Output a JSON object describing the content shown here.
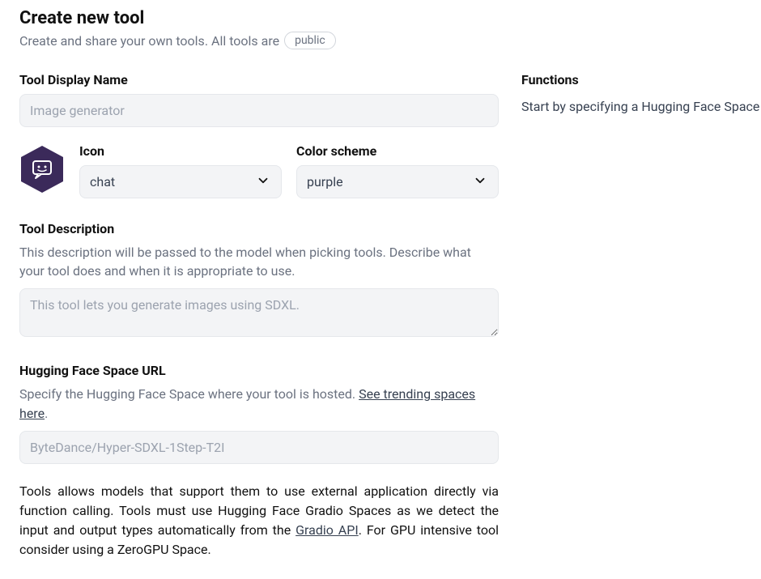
{
  "header": {
    "title": "Create new tool",
    "subtitle_prefix": "Create and share your own tools. All tools are",
    "badge": "public"
  },
  "form": {
    "display_name": {
      "label": "Tool Display Name",
      "placeholder": "Image generator",
      "value": ""
    },
    "icon": {
      "label": "Icon",
      "selected": "chat"
    },
    "color_scheme": {
      "label": "Color scheme",
      "selected": "purple"
    },
    "description": {
      "label": "Tool Description",
      "helper": "This description will be passed to the model when picking tools. Describe what your tool does and when it is appropriate to use.",
      "placeholder": "This tool lets you generate images using SDXL.",
      "value": ""
    },
    "space_url": {
      "label": "Hugging Face Space URL",
      "helper_prefix": "Specify the Hugging Face Space where your tool is hosted. ",
      "helper_link": "See trending spaces here",
      "helper_suffix": ".",
      "placeholder": "ByteDance/Hyper-SDXL-1Step-T2I",
      "value": ""
    },
    "footnote_pre": "Tools allows models that support them to use external application directly via function calling. Tools must use Hugging Face Gradio Spaces as we detect the input and output types automatically from the ",
    "footnote_link": "Gradio API",
    "footnote_post": ". For GPU intensive tool consider using a ZeroGPU Space."
  },
  "functions": {
    "title": "Functions",
    "text": "Start by specifying a Hugging Face Space URL."
  }
}
